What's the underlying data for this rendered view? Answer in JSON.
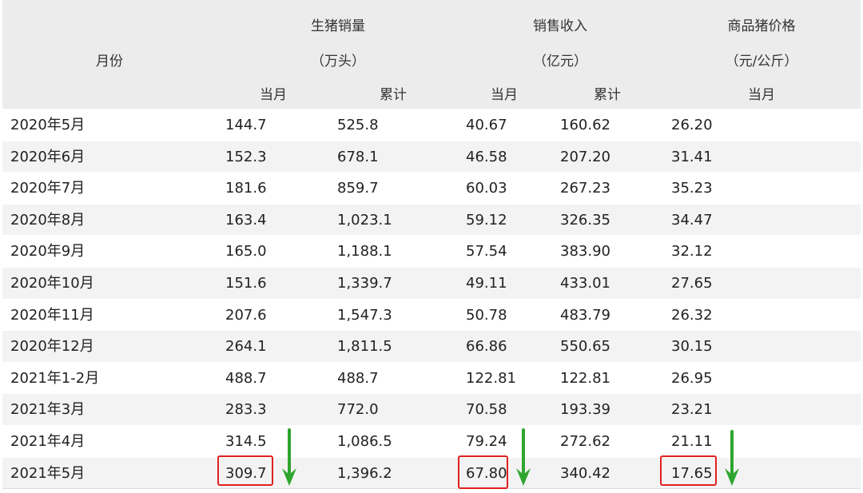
{
  "header": {
    "month_label": "月份",
    "sales_volume": {
      "title": "生猪销量",
      "unit": "（万头）",
      "monthly": "当月",
      "cumulative": "累计"
    },
    "revenue": {
      "title": "销售收入",
      "unit": "（亿元）",
      "monthly": "当月",
      "cumulative": "累计"
    },
    "price": {
      "title": "商品猪价格",
      "unit": "（元/公斤）",
      "monthly": "当月"
    }
  },
  "rows": [
    {
      "month": "2020年5月",
      "sales_monthly": "144.7",
      "sales_cumulative": "525.8",
      "revenue_monthly": "40.67",
      "revenue_cumulative": "160.62",
      "price_monthly": "26.20"
    },
    {
      "month": "2020年6月",
      "sales_monthly": "152.3",
      "sales_cumulative": "678.1",
      "revenue_monthly": "46.58",
      "revenue_cumulative": "207.20",
      "price_monthly": "31.41"
    },
    {
      "month": "2020年7月",
      "sales_monthly": "181.6",
      "sales_cumulative": "859.7",
      "revenue_monthly": "60.03",
      "revenue_cumulative": "267.23",
      "price_monthly": "35.23"
    },
    {
      "month": "2020年8月",
      "sales_monthly": "163.4",
      "sales_cumulative": "1,023.1",
      "revenue_monthly": "59.12",
      "revenue_cumulative": "326.35",
      "price_monthly": "34.47"
    },
    {
      "month": "2020年9月",
      "sales_monthly": "165.0",
      "sales_cumulative": "1,188.1",
      "revenue_monthly": "57.54",
      "revenue_cumulative": "383.90",
      "price_monthly": "32.12"
    },
    {
      "month": "2020年10月",
      "sales_monthly": "151.6",
      "sales_cumulative": "1,339.7",
      "revenue_monthly": "49.11",
      "revenue_cumulative": "433.01",
      "price_monthly": "27.65"
    },
    {
      "month": "2020年11月",
      "sales_monthly": "207.6",
      "sales_cumulative": "1,547.3",
      "revenue_monthly": "50.78",
      "revenue_cumulative": "483.79",
      "price_monthly": "26.32"
    },
    {
      "month": "2020年12月",
      "sales_monthly": "264.1",
      "sales_cumulative": "1,811.5",
      "revenue_monthly": "66.86",
      "revenue_cumulative": "550.65",
      "price_monthly": "30.15"
    },
    {
      "month": "2021年1-2月",
      "sales_monthly": "488.7",
      "sales_cumulative": "488.7",
      "revenue_monthly": "122.81",
      "revenue_cumulative": "122.81",
      "price_monthly": "26.95"
    },
    {
      "month": "2021年3月",
      "sales_monthly": "283.3",
      "sales_cumulative": "772.0",
      "revenue_monthly": "70.58",
      "revenue_cumulative": "193.39",
      "price_monthly": "23.21"
    },
    {
      "month": "2021年4月",
      "sales_monthly": "314.5",
      "sales_cumulative": "1,086.5",
      "revenue_monthly": "79.24",
      "revenue_cumulative": "272.62",
      "price_monthly": "21.11"
    },
    {
      "month": "2021年5月",
      "sales_monthly": "309.7",
      "sales_cumulative": "1,396.2",
      "revenue_monthly": "67.80",
      "revenue_cumulative": "340.42",
      "price_monthly": "17.65"
    }
  ],
  "colors": {
    "highlight": "#e02020",
    "arrow": "#2fa52f",
    "header_bg": "#ececec",
    "alt_row_bg": "#f3f3f3"
  }
}
